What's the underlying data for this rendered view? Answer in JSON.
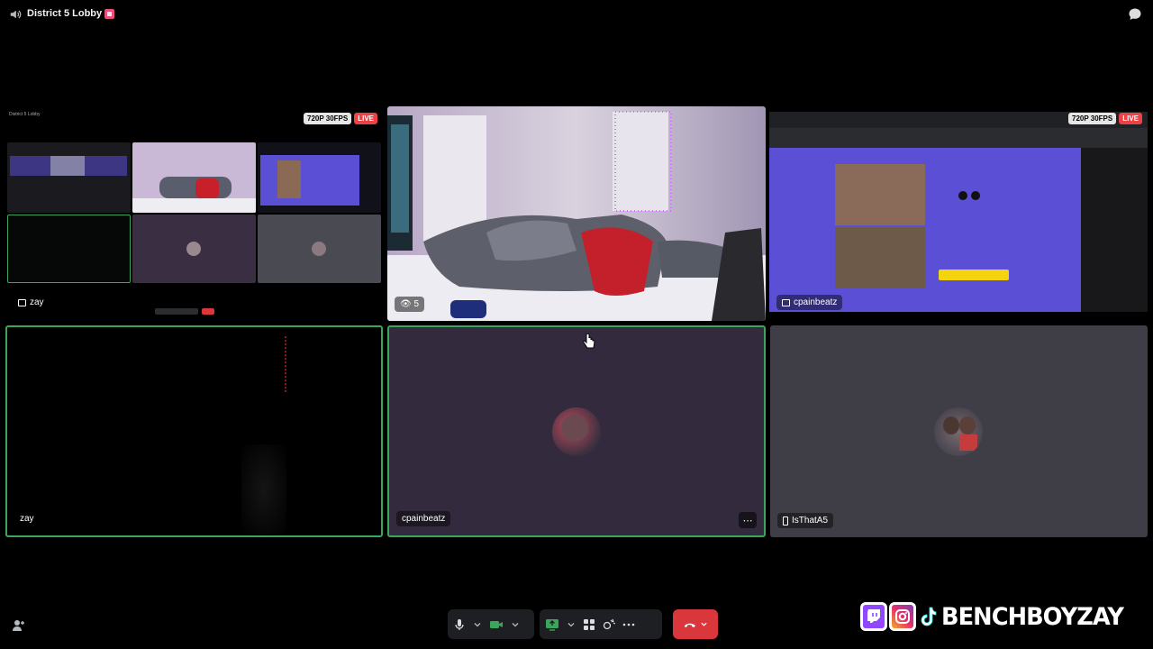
{
  "header": {
    "channel_title": "District 5 Lobby",
    "speaker_icon": "speaker-icon",
    "chat_icon": "chat-bubble-icon"
  },
  "tiles": {
    "screen_zay": {
      "name": "zay",
      "quality": "720P 30FPS",
      "live": "LIVE"
    },
    "webcam": {
      "viewers": "5"
    },
    "screen_cpain": {
      "name": "cpainbeatz",
      "quality": "720P 30FPS",
      "live": "LIVE"
    },
    "cam_zay": {
      "name": "zay"
    },
    "cam_cpain": {
      "name": "cpainbeatz",
      "more": "⋯"
    },
    "cam_isthat": {
      "name": "IsThatA5"
    }
  },
  "controls": {
    "mic_icon": "microphone-icon",
    "camera_icon": "video-camera-icon",
    "screenshare_icon": "screen-share-icon",
    "activities_icon": "activities-icon",
    "soundboard_icon": "soundboard-icon",
    "more_icon": "more-options-icon",
    "hangup_icon": "phone-hangup-icon"
  },
  "overlay": {
    "handle": "BENCHBOYZAY"
  },
  "colors": {
    "speaking": "#3ba55c",
    "live": "#ed4245",
    "hangup": "#da373c",
    "twitch": "#9146ff"
  }
}
